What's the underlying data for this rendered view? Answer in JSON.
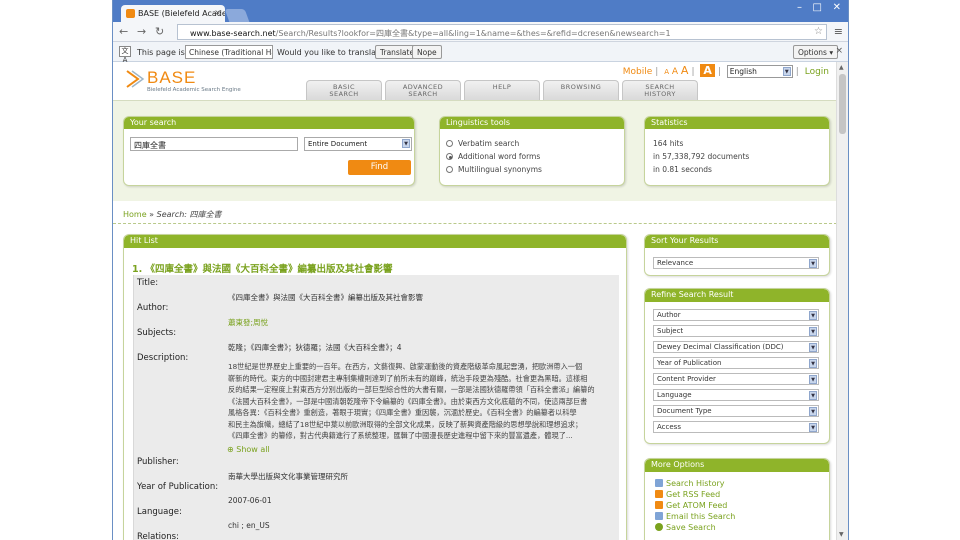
{
  "browser": {
    "tab_title": "BASE (Bielefeld Academic S",
    "url_host": "www.base-search.net",
    "url_path": "/Search/Results?lookfor=四庫全書&type=all&ling=1&name=&thes=&refid=dcresen&newsearch=1"
  },
  "translate_bar": {
    "prefix": "This page is in",
    "language": "Chinese (Traditional Han)",
    "question": "Would you like to translate it?",
    "translate_button": "Translate",
    "nope_button": "Nope",
    "options_button": "Options"
  },
  "header": {
    "logo_text": "BASE",
    "logo_subtitle": "Bielefeld Academic Search Engine",
    "mobile_link": "Mobile",
    "font_sizes": [
      "A",
      "A",
      "A",
      "A"
    ],
    "language": "English",
    "login_link": "Login",
    "nav_tabs": [
      {
        "line1": "BASIC",
        "line2": "SEARCH"
      },
      {
        "line1": "ADVANCED",
        "line2": "SEARCH"
      },
      {
        "line1": "HELP",
        "line2": ""
      },
      {
        "line1": "BROWSING",
        "line2": ""
      },
      {
        "line1": "SEARCH",
        "line2": "HISTORY"
      }
    ]
  },
  "your_search": {
    "heading": "Your search",
    "query": "四庫全書",
    "scope": "Entire Document",
    "find_button": "Find"
  },
  "linguistics": {
    "heading": "Linguistics tools",
    "options": [
      "Verbatim search",
      "Additional word forms",
      "Multilingual synonyms"
    ],
    "selected_index": 1
  },
  "statistics": {
    "heading": "Statistics",
    "hits": "164 hits",
    "docs": "in 57,338,792 documents",
    "time": "in 0.81 seconds"
  },
  "breadcrumb": {
    "home": "Home",
    "separator": "»",
    "search_label": "Search: 四庫全書"
  },
  "hit_list": {
    "heading": "Hit List",
    "first_result": {
      "title_line": "1. 《四庫全書》與法國《大百科全書》編纂出版及其社會影響",
      "labels": {
        "title": "Title:",
        "author": "Author:",
        "subjects": "Subjects:",
        "description": "Description:",
        "publisher": "Publisher:",
        "year": "Year of Publication:",
        "language": "Language:",
        "relations": "Relations:"
      },
      "title": "《四庫全書》與法國《大百科全書》編纂出版及其社會影響",
      "author": "蕭東發;周悅",
      "subjects": "乾隆；《四庫全書》；狄德羅；法國《大百科全書》；4",
      "description_lines": [
        "18世紀是世界歷史上重要的一百年。在西方，文藝復興、啟蒙運動後的資產階級革命風起雲湧，把歐洲帶入一個",
        "嶄新的時代。東方的中國封建君主專制集權則達到了前所未有的巔峰，統治手段更為殘酷。社會更為黑暗。這樣相",
        "反的結果一定程度上對東西方分別出版的一部巨型綜合性的大書有關，一部是法國狄德羅帶領「百科全書派」編纂的",
        "《法國大百科全書》，一部是中國清朝乾隆帝下令編纂的《四庫全書》。由於東西方文化底蘊的不同，使這兩部巨書",
        "風格各異：《百科全書》重創造，著眼于現實；《四庫全書》重因襲，沉湎於歷史。《百科全書》的編纂者以科學",
        "和民主為旗幟，總結了18世紀中葉以前歐洲取得的全部文化成果，反映了新興資產階級的思想學說和理想追求；",
        "《四庫全書》的纂修，對古代典籍進行了系統整理，匯輯了中國漫長歷史進程中留下來的豐富遺產，體現了..."
      ],
      "show_all": "Show all",
      "publisher": "南華大學出版與文化事業管理研究所",
      "year": "2007-06-01",
      "language": "chi ; en_US"
    }
  },
  "sort": {
    "heading": "Sort Your Results",
    "value": "Relevance"
  },
  "refine": {
    "heading": "Refine Search Result",
    "filters": [
      "Author",
      "Subject",
      "Dewey Decimal Classification (DDC)",
      "Year of Publication",
      "Content Provider",
      "Language",
      "Document Type",
      "Access"
    ]
  },
  "more_options": {
    "heading": "More Options",
    "items": [
      {
        "label": "Search History",
        "icon": "history-icon",
        "color": "#7fa4d6"
      },
      {
        "label": "Get RSS Feed",
        "icon": "rss-icon",
        "color": "#f08a12"
      },
      {
        "label": "Get ATOM Feed",
        "icon": "atom-icon",
        "color": "#f08a12"
      },
      {
        "label": "Email this Search",
        "icon": "email-icon",
        "color": "#7fa4d6"
      },
      {
        "label": "Save Search",
        "icon": "save-icon",
        "color": "#7aa21e"
      }
    ]
  },
  "colors": {
    "accent_green": "#8fb42a",
    "link_green": "#7aa21e",
    "brand_orange": "#f08a12",
    "browser_blue": "#4f7cc6"
  }
}
